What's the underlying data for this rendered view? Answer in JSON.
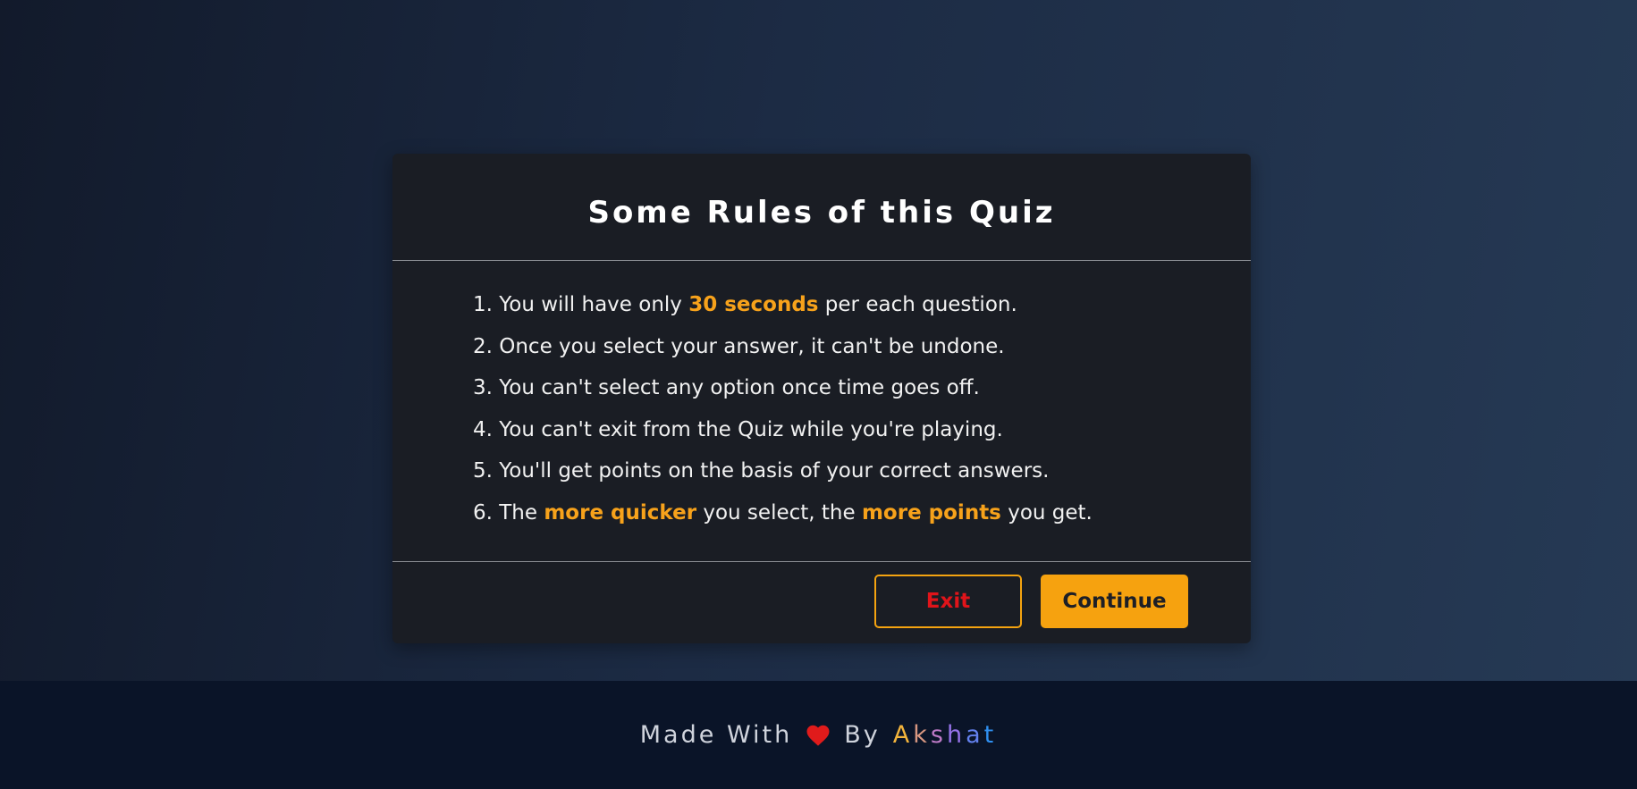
{
  "card": {
    "title": "Some Rules of this Quiz",
    "rules": [
      {
        "prefix": "1. You will have only ",
        "highlight": "30 seconds",
        "suffix": " per each question."
      },
      {
        "text": "2. Once you select your answer, it can't be undone."
      },
      {
        "text": "3. You can't select any option once time goes off."
      },
      {
        "text": "4. You can't exit from the Quiz while you're playing."
      },
      {
        "text": "5. You'll get points on the basis of your correct answers."
      },
      {
        "prefix": "6. The ",
        "highlight": "more quicker",
        "middle": " you select, the ",
        "highlight2": "more points",
        "suffix": " you get."
      }
    ],
    "exit_label": "Exit",
    "continue_label": "Continue"
  },
  "footer": {
    "made_with": "Made With",
    "heart_icon": "heart-icon",
    "by": "By",
    "author": "Akshat"
  },
  "colors": {
    "accent": "#f6a20f",
    "exit_text": "#e0141a",
    "heart": "#e01b1b",
    "author_gradient": [
      "#f3b43c",
      "#b06ce8",
      "#2f8ff0"
    ]
  }
}
